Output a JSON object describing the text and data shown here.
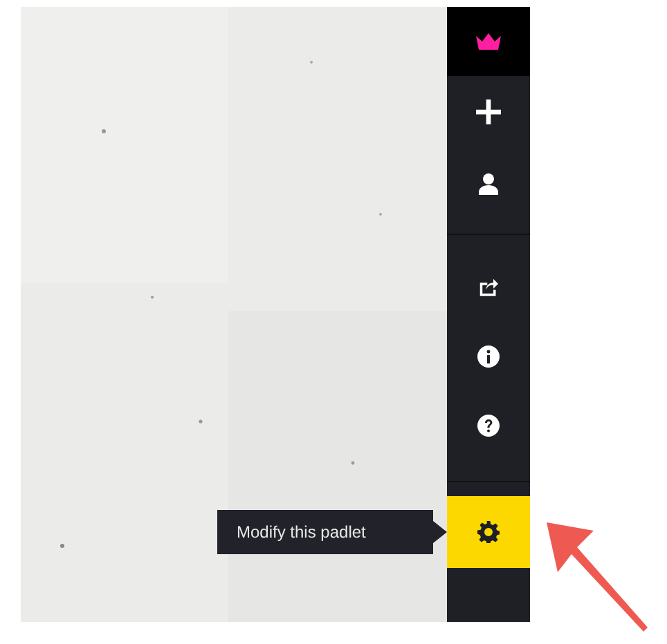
{
  "sidebar": {
    "groups": [
      [
        {
          "kind": "add",
          "selected": false
        },
        {
          "kind": "person",
          "selected": false
        }
      ],
      [
        {
          "kind": "share",
          "selected": false
        },
        {
          "kind": "info",
          "selected": false
        },
        {
          "kind": "help",
          "selected": false
        }
      ],
      [
        {
          "kind": "settings",
          "selected": true,
          "tooltip": "Modify this padlet"
        }
      ]
    ]
  }
}
